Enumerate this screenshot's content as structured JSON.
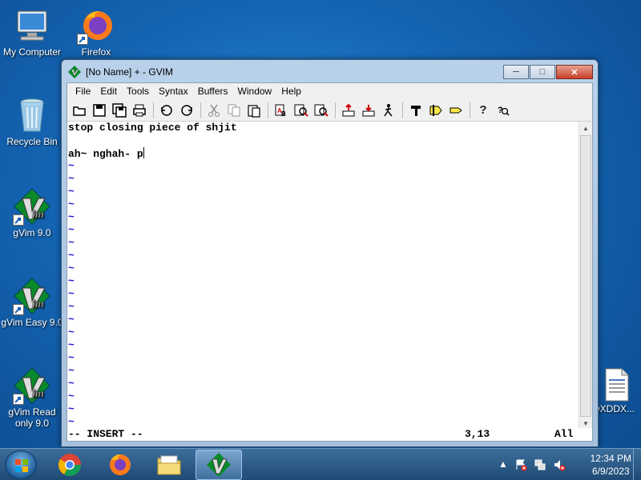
{
  "desktop": {
    "icons": [
      {
        "label": "My Computer"
      },
      {
        "label": "Firefox"
      },
      {
        "label": "Recycle Bin"
      },
      {
        "label": "gVim 9.0"
      },
      {
        "label": "gVim Easy 9.0"
      },
      {
        "label": "gVim Read only 9.0"
      },
      {
        "label": "DXDDX..."
      }
    ]
  },
  "window": {
    "title": "[No Name] + - GVIM",
    "menu": [
      "File",
      "Edit",
      "Tools",
      "Syntax",
      "Buffers",
      "Window",
      "Help"
    ],
    "toolbar": [
      "open-icon",
      "save-icon",
      "save-all-icon",
      "print-icon",
      "undo-icon",
      "redo-icon",
      "cut-icon",
      "copy-icon",
      "paste-icon",
      "find-replace-icon",
      "find-next-icon",
      "find-prev-icon",
      "load-session-icon",
      "save-session-icon",
      "run-script-icon",
      "make-icon",
      "ctags-icon",
      "jump-tag-icon",
      "help-icon",
      "find-help-icon"
    ],
    "buffer": {
      "line1": "stop closing piece of shjit",
      "line2": "",
      "line3": "ah~ nghah- p",
      "tilde": "~"
    },
    "status": {
      "mode": "-- INSERT --",
      "position": "3,13",
      "percent": "All"
    }
  },
  "taskbar": {
    "time": "12:34 PM",
    "date": "6/9/2023"
  }
}
